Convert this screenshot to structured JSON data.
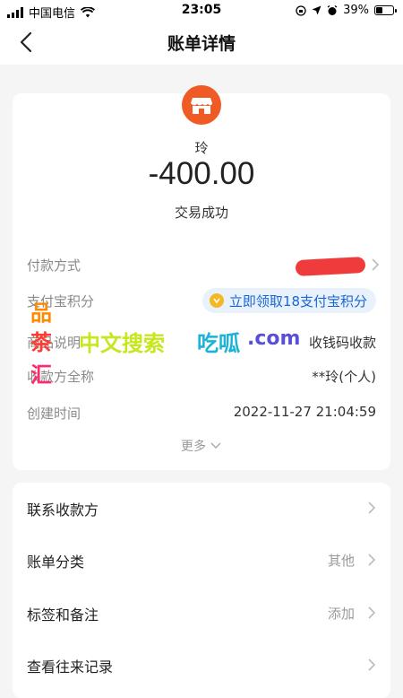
{
  "status_bar": {
    "carrier": "中国电信",
    "time": "23:05",
    "battery": "39%",
    "battery_level": 0.39
  },
  "nav": {
    "title": "账单详情"
  },
  "summary": {
    "payee": "玲",
    "amount": "-400.00",
    "status": "交易成功"
  },
  "details": [
    {
      "label": "付款方式",
      "value": ""
    },
    {
      "label": "支付宝积分",
      "value": "立即领取18支付宝积分"
    },
    {
      "label": "商品说明",
      "value": "收钱码收款"
    },
    {
      "label": "收款方全称",
      "value": "**玲(个人)"
    },
    {
      "label": "创建时间",
      "value": "2022-11-27 21:04:59"
    }
  ],
  "more_label": "更多",
  "watermark": {
    "vertical": [
      "品",
      "茶",
      "汇"
    ],
    "text": "中文搜索",
    "site": "吃呱",
    "tld": ".com"
  },
  "menu": [
    {
      "label": "联系收款方",
      "value": ""
    },
    {
      "label": "账单分类",
      "value": "其他"
    },
    {
      "label": "标签和备注",
      "value": "添加"
    },
    {
      "label": "查看往来记录",
      "value": ""
    }
  ],
  "colors": {
    "accent": "#f05a24",
    "link": "#1a66d6",
    "redaction": "#ee2a2a"
  }
}
